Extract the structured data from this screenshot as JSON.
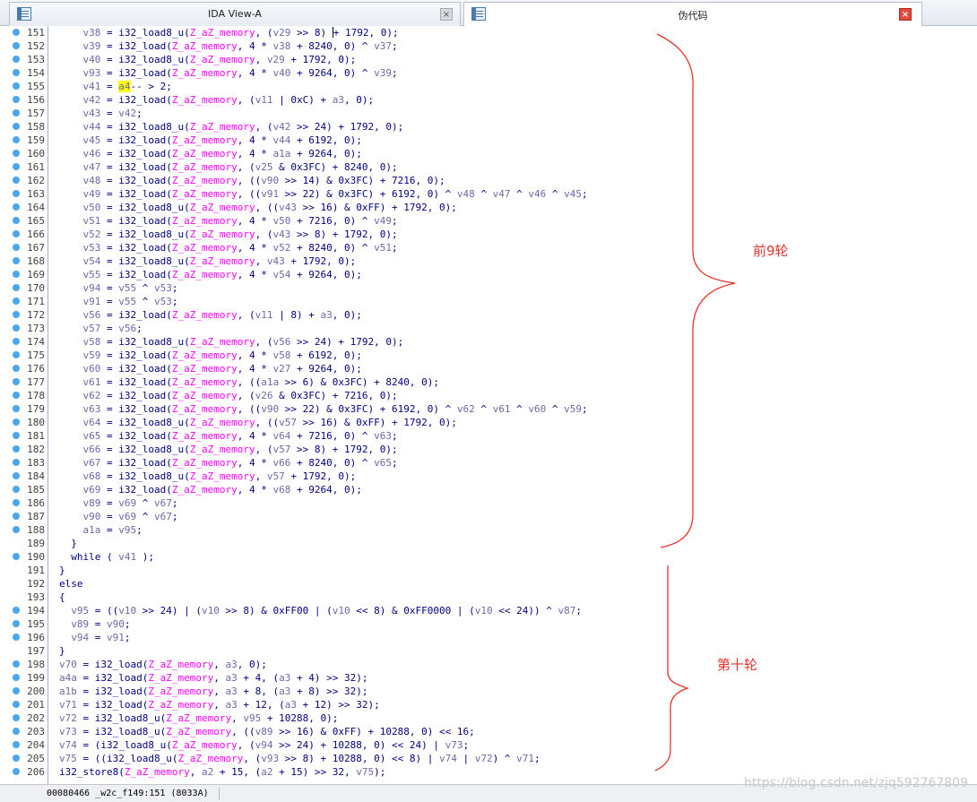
{
  "tabs": [
    {
      "label": "IDA View-A",
      "icon": "disassembly-view-icon",
      "close": "×",
      "active": false
    },
    {
      "label": "伪代码",
      "icon": "pseudocode-view-icon",
      "close": "×",
      "active": true
    }
  ],
  "code": {
    "lines": [
      {
        "n": "151",
        "d": true,
        "t": "    v38 = i32_load8_u(Z_aZ_memory, (v29 >> 8) |+ 1792, 0);"
      },
      {
        "n": "152",
        "d": true,
        "t": "    v39 = i32_load(Z_aZ_memory, 4 * v38 + 8240, 0) ^ v37;"
      },
      {
        "n": "153",
        "d": true,
        "t": "    v40 = i32_load8_u(Z_aZ_memory, v29 + 1792, 0);"
      },
      {
        "n": "154",
        "d": true,
        "t": "    v93 = i32_load(Z_aZ_memory, 4 * v40 + 9264, 0) ^ v39;"
      },
      {
        "n": "155",
        "d": true,
        "t": "    v41 = a4-- > 2;"
      },
      {
        "n": "156",
        "d": true,
        "t": "    v42 = i32_load(Z_aZ_memory, (v11 | 0xC) + a3, 0);"
      },
      {
        "n": "157",
        "d": true,
        "t": "    v43 = v42;"
      },
      {
        "n": "158",
        "d": true,
        "t": "    v44 = i32_load8_u(Z_aZ_memory, (v42 >> 24) + 1792, 0);"
      },
      {
        "n": "159",
        "d": true,
        "t": "    v45 = i32_load(Z_aZ_memory, 4 * v44 + 6192, 0);"
      },
      {
        "n": "160",
        "d": true,
        "t": "    v46 = i32_load(Z_aZ_memory, 4 * a1a + 9264, 0);"
      },
      {
        "n": "161",
        "d": true,
        "t": "    v47 = i32_load(Z_aZ_memory, (v25 & 0x3FC) + 8240, 0);"
      },
      {
        "n": "162",
        "d": true,
        "t": "    v48 = i32_load(Z_aZ_memory, ((v90 >> 14) & 0x3FC) + 7216, 0);"
      },
      {
        "n": "163",
        "d": true,
        "t": "    v49 = i32_load(Z_aZ_memory, ((v91 >> 22) & 0x3FC) + 6192, 0) ^ v48 ^ v47 ^ v46 ^ v45;"
      },
      {
        "n": "164",
        "d": true,
        "t": "    v50 = i32_load8_u(Z_aZ_memory, ((v43 >> 16) & 0xFF) + 1792, 0);"
      },
      {
        "n": "165",
        "d": true,
        "t": "    v51 = i32_load(Z_aZ_memory, 4 * v50 + 7216, 0) ^ v49;"
      },
      {
        "n": "166",
        "d": true,
        "t": "    v52 = i32_load8_u(Z_aZ_memory, (v43 >> 8) + 1792, 0);"
      },
      {
        "n": "167",
        "d": true,
        "t": "    v53 = i32_load(Z_aZ_memory, 4 * v52 + 8240, 0) ^ v51;"
      },
      {
        "n": "168",
        "d": true,
        "t": "    v54 = i32_load8_u(Z_aZ_memory, v43 + 1792, 0);"
      },
      {
        "n": "169",
        "d": true,
        "t": "    v55 = i32_load(Z_aZ_memory, 4 * v54 + 9264, 0);"
      },
      {
        "n": "170",
        "d": true,
        "t": "    v94 = v55 ^ v53;"
      },
      {
        "n": "171",
        "d": true,
        "t": "    v91 = v55 ^ v53;"
      },
      {
        "n": "172",
        "d": true,
        "t": "    v56 = i32_load(Z_aZ_memory, (v11 | 8) + a3, 0);"
      },
      {
        "n": "173",
        "d": true,
        "t": "    v57 = v56;"
      },
      {
        "n": "174",
        "d": true,
        "t": "    v58 = i32_load8_u(Z_aZ_memory, (v56 >> 24) + 1792, 0);"
      },
      {
        "n": "175",
        "d": true,
        "t": "    v59 = i32_load(Z_aZ_memory, 4 * v58 + 6192, 0);"
      },
      {
        "n": "176",
        "d": true,
        "t": "    v60 = i32_load(Z_aZ_memory, 4 * v27 + 9264, 0);"
      },
      {
        "n": "177",
        "d": true,
        "t": "    v61 = i32_load(Z_aZ_memory, ((a1a >> 6) & 0x3FC) + 8240, 0);"
      },
      {
        "n": "178",
        "d": true,
        "t": "    v62 = i32_load(Z_aZ_memory, (v26 & 0x3FC) + 7216, 0);"
      },
      {
        "n": "179",
        "d": true,
        "t": "    v63 = i32_load(Z_aZ_memory, ((v90 >> 22) & 0x3FC) + 6192, 0) ^ v62 ^ v61 ^ v60 ^ v59;"
      },
      {
        "n": "180",
        "d": true,
        "t": "    v64 = i32_load8_u(Z_aZ_memory, ((v57 >> 16) & 0xFF) + 1792, 0);"
      },
      {
        "n": "181",
        "d": true,
        "t": "    v65 = i32_load(Z_aZ_memory, 4 * v64 + 7216, 0) ^ v63;"
      },
      {
        "n": "182",
        "d": true,
        "t": "    v66 = i32_load8_u(Z_aZ_memory, (v57 >> 8) + 1792, 0);"
      },
      {
        "n": "183",
        "d": true,
        "t": "    v67 = i32_load(Z_aZ_memory, 4 * v66 + 8240, 0) ^ v65;"
      },
      {
        "n": "184",
        "d": true,
        "t": "    v68 = i32_load8_u(Z_aZ_memory, v57 + 1792, 0);"
      },
      {
        "n": "185",
        "d": true,
        "t": "    v69 = i32_load(Z_aZ_memory, 4 * v68 + 9264, 0);"
      },
      {
        "n": "186",
        "d": true,
        "t": "    v89 = v69 ^ v67;"
      },
      {
        "n": "187",
        "d": true,
        "t": "    v90 = v69 ^ v67;"
      },
      {
        "n": "188",
        "d": true,
        "t": "    a1a = v95;"
      },
      {
        "n": "189",
        "d": false,
        "t": "  }"
      },
      {
        "n": "190",
        "d": true,
        "t": "  while ( v41 );"
      },
      {
        "n": "191",
        "d": false,
        "t": "}"
      },
      {
        "n": "192",
        "d": false,
        "t": "else"
      },
      {
        "n": "193",
        "d": false,
        "t": "{"
      },
      {
        "n": "194",
        "d": true,
        "t": "  v95 = ((v10 >> 24) | (v10 >> 8) & 0xFF00 | (v10 << 8) & 0xFF0000 | (v10 << 24)) ^ v87;"
      },
      {
        "n": "195",
        "d": true,
        "t": "  v89 = v90;"
      },
      {
        "n": "196",
        "d": true,
        "t": "  v94 = v91;"
      },
      {
        "n": "197",
        "d": false,
        "t": "}"
      },
      {
        "n": "198",
        "d": true,
        "t": "v70 = i32_load(Z_aZ_memory, a3, 0);"
      },
      {
        "n": "199",
        "d": true,
        "t": "a4a = i32_load(Z_aZ_memory, a3 + 4, (a3 + 4) >> 32);"
      },
      {
        "n": "200",
        "d": true,
        "t": "a1b = i32_load(Z_aZ_memory, a3 + 8, (a3 + 8) >> 32);"
      },
      {
        "n": "201",
        "d": true,
        "t": "v71 = i32_load(Z_aZ_memory, a3 + 12, (a3 + 12) >> 32);"
      },
      {
        "n": "202",
        "d": true,
        "t": "v72 = i32_load8_u(Z_aZ_memory, v95 + 10288, 0);"
      },
      {
        "n": "203",
        "d": true,
        "t": "v73 = i32_load8_u(Z_aZ_memory, ((v89 >> 16) & 0xFF) + 10288, 0) << 16;"
      },
      {
        "n": "204",
        "d": true,
        "t": "v74 = (i32_load8_u(Z_aZ_memory, (v94 >> 24) + 10288, 0) << 24) | v73;"
      },
      {
        "n": "205",
        "d": true,
        "t": "v75 = ((i32_load8_u(Z_aZ_memory, (v93 >> 8) + 10288, 0) << 8) | v74 | v72) ^ v71;"
      },
      {
        "n": "206",
        "d": true,
        "t": "i32_store8(Z_aZ_memory, a2 + 15, (a2 + 15) >> 32, v75);"
      }
    ],
    "highlight_token": "a4",
    "highlight_color": "#ffff00"
  },
  "annotations": {
    "first_nine_rounds": "前9轮",
    "tenth_round": "第十轮",
    "color": "#e8322a"
  },
  "statusbar": {
    "text": "00080466 _w2c_f149:151 (8033A)"
  },
  "watermark": "https://blog.csdn.net/zjq592767809",
  "colors": {
    "function": "#000080",
    "memory_symbol": "#ff00ff",
    "variable": "#6a6aa8",
    "breakpoint_dot": "#4aa7ee"
  }
}
